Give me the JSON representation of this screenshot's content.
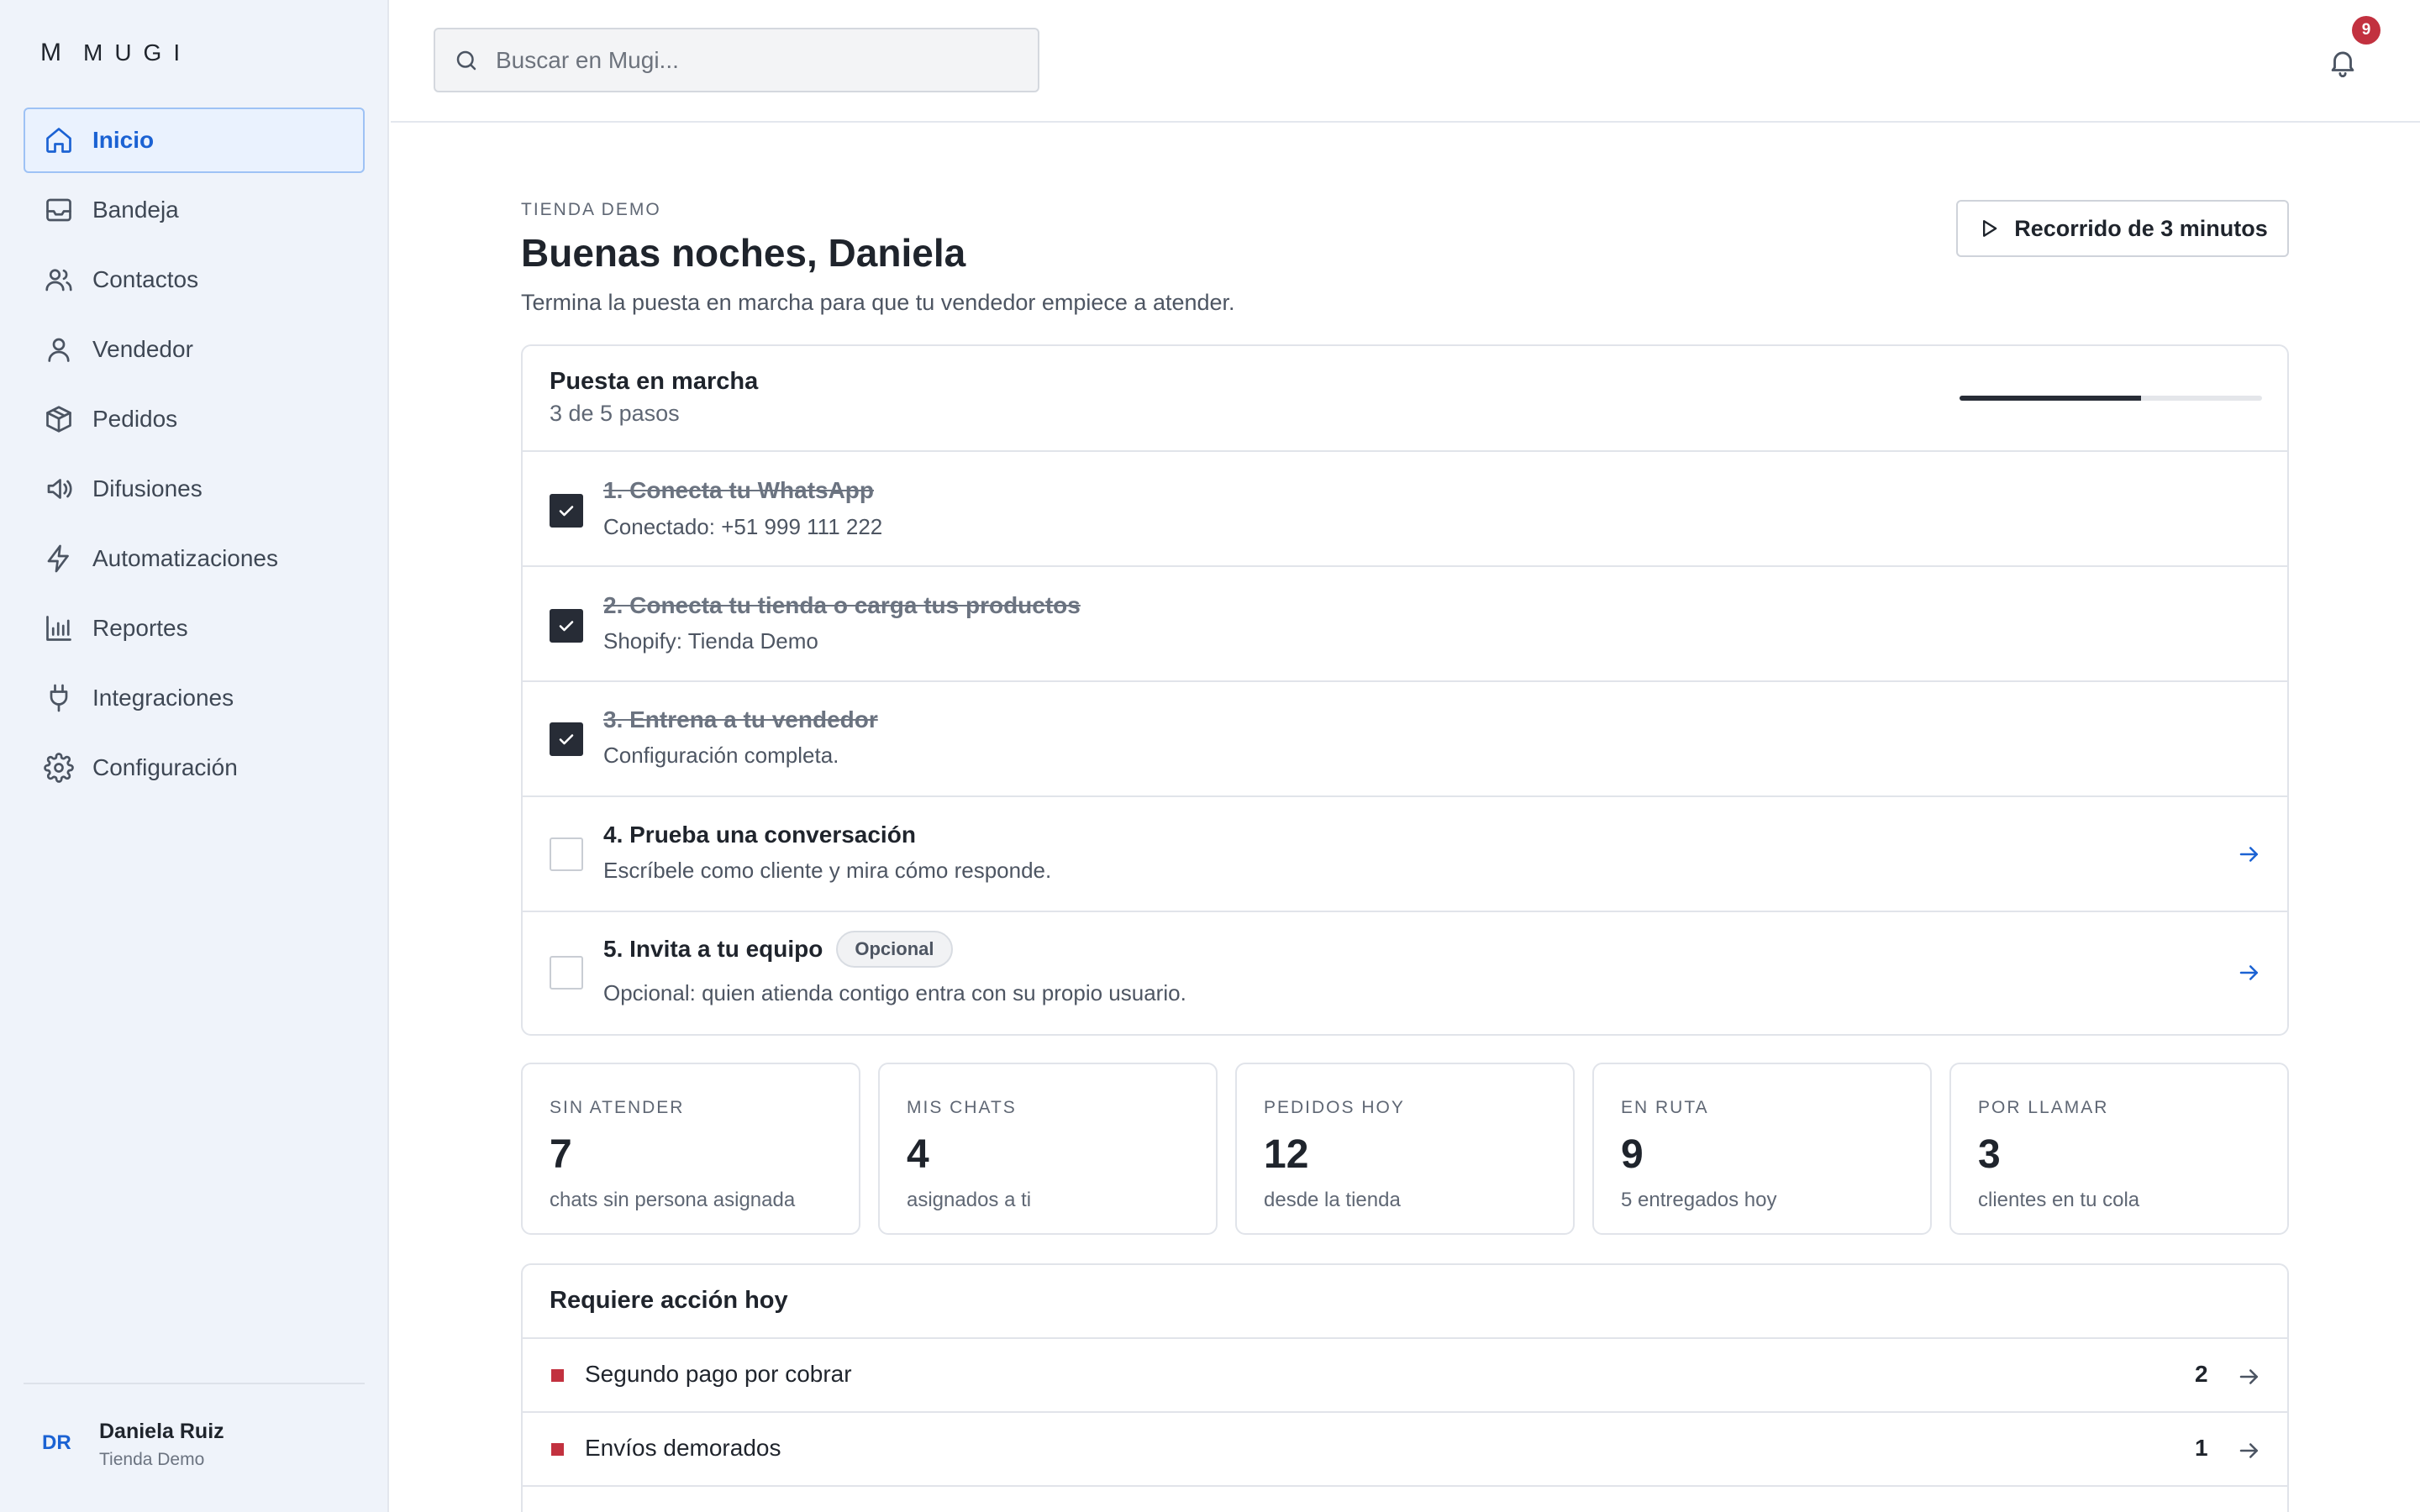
{
  "brand": {
    "mark": "M",
    "name": "MUGI"
  },
  "sidebar": {
    "items": [
      {
        "label": "Inicio",
        "icon": "home-icon",
        "active": true
      },
      {
        "label": "Bandeja",
        "icon": "inbox-icon"
      },
      {
        "label": "Contactos",
        "icon": "users-icon"
      },
      {
        "label": "Vendedor",
        "icon": "user-icon"
      },
      {
        "label": "Pedidos",
        "icon": "package-icon"
      },
      {
        "label": "Difusiones",
        "icon": "megaphone-icon"
      },
      {
        "label": "Automatizaciones",
        "icon": "bolt-icon"
      },
      {
        "label": "Reportes",
        "icon": "bar-chart-icon"
      },
      {
        "label": "Integraciones",
        "icon": "plug-icon"
      },
      {
        "label": "Configuración",
        "icon": "gear-icon"
      }
    ],
    "user": {
      "initials": "DR",
      "name": "Daniela Ruiz",
      "store": "Tienda Demo"
    }
  },
  "topbar": {
    "search_placeholder": "Buscar en Mugi...",
    "notifications_count": "9"
  },
  "header": {
    "eyebrow": "TIENDA DEMO",
    "title": "Buenas noches, Daniela",
    "subtitle": "Termina la puesta en marcha para que tu vendedor empiece a atender.",
    "tour_label": "Recorrido de 3 minutos"
  },
  "setup": {
    "title": "Puesta en marcha",
    "progress_label": "3 de 5 pasos",
    "progress_fraction": 0.6,
    "steps": [
      {
        "title": "1. Conecta tu WhatsApp",
        "desc": "Conectado: +51 999 111 222",
        "done": true
      },
      {
        "title": "2. Conecta tu tienda o carga tus productos",
        "desc": "Shopify: Tienda Demo",
        "done": true
      },
      {
        "title": "3. Entrena a tu vendedor",
        "desc": "Configuración completa.",
        "done": true
      },
      {
        "title": "4. Prueba una conversación",
        "desc": "Escríbele como cliente y mira cómo responde.",
        "done": false
      },
      {
        "title": "5. Invita a tu equipo",
        "tag": "Opcional",
        "desc": "Opcional: quien atienda contigo entra con su propio usuario.",
        "done": false
      }
    ]
  },
  "stats": [
    {
      "label": "SIN ATENDER",
      "value": "7",
      "sub": "chats sin persona asignada"
    },
    {
      "label": "MIS CHATS",
      "value": "4",
      "sub": "asignados a ti"
    },
    {
      "label": "PEDIDOS HOY",
      "value": "12",
      "sub": "desde la tienda"
    },
    {
      "label": "EN RUTA",
      "value": "9",
      "sub": "5 entregados hoy"
    },
    {
      "label": "POR LLAMAR",
      "value": "3",
      "sub": "clientes en tu cola"
    }
  ],
  "actions": {
    "title": "Requiere acción hoy",
    "items": [
      {
        "label": "Segundo pago por cobrar",
        "count": "2"
      },
      {
        "label": "Envíos demorados",
        "count": "1"
      }
    ]
  },
  "colors": {
    "accent": "#1b62d3",
    "alert": "#c2313f",
    "dark": "#272c36",
    "sidebar_bg": "#eff3fa"
  }
}
